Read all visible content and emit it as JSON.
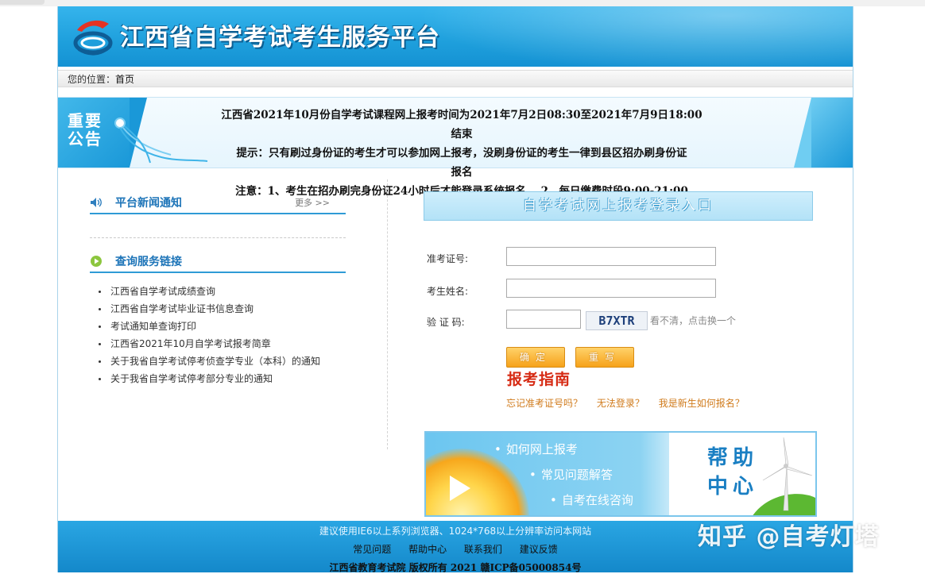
{
  "header": {
    "site_title": "江西省自学考试考生服务平台"
  },
  "breadcrumb": {
    "label": "您的位置：",
    "current": "首页"
  },
  "notice": {
    "badge_line1": "重要",
    "badge_line2": "公告",
    "line1": "江西省2021年10月份自学考试课程网上报考时间为2021年7月2日08:30至2021年7月9日18:00",
    "line2": "结束",
    "line3": "提示：只有刷过身份证的考生才可以参加网上报考，没刷身份证的考生一律到县区招办刷身份证",
    "line4": "报名",
    "line5": "注意：1、考生在招办刷完身份证24小时后才能登录系统报名    2、每日缴费时段9:00-21:00"
  },
  "news": {
    "title": "平台新闻通知",
    "more": "更多 >>"
  },
  "query": {
    "title": "查询服务链接",
    "links": [
      "江西省自学考试成绩查询",
      "江西省自学考试毕业证书信息查询",
      "考试通知单查询打印",
      "江西省2021年10月自学考试报考简章",
      "关于我省自学考试停考侦查学专业（本科）的通知",
      "关于我省自学考试停考部分专业的通知"
    ]
  },
  "login": {
    "title": "自学考试网上报考登录入口",
    "ticket_label": "准考证号:",
    "ticket_value": "",
    "name_label": "考生姓名:",
    "name_value": "",
    "code_label": "验 证 码:",
    "code_value": "",
    "captcha_text": "B7XTR",
    "captcha_hint": "看不清，点击换一个",
    "submit_label": "确定",
    "reset_label": "重写",
    "guide_title": "报考指南",
    "help_links": [
      "忘记准考证号吗？",
      "无法登录？",
      "我是新生如何报名？"
    ]
  },
  "banner": {
    "items": [
      "如何网上报考",
      "常见问题解答",
      "自考在线咨询"
    ],
    "help_line1": "帮助",
    "help_line2": "中心"
  },
  "footer": {
    "browser_note": "建议使用IE6以上系列浏览器、1024*768以上分辨率访问本网站",
    "links": [
      "常见问题",
      "帮助中心",
      "联系我们",
      "建议反馈"
    ],
    "copyright": "江西省教育考试院  版权所有  2021  赣ICP备05000854号"
  },
  "watermark": "知乎 @自考灯塔",
  "colors": {
    "header_blue": "#1e9fdc",
    "accent_orange": "#f6a21a",
    "guide_red": "#d62a13",
    "link_orange": "#d07b1c"
  }
}
